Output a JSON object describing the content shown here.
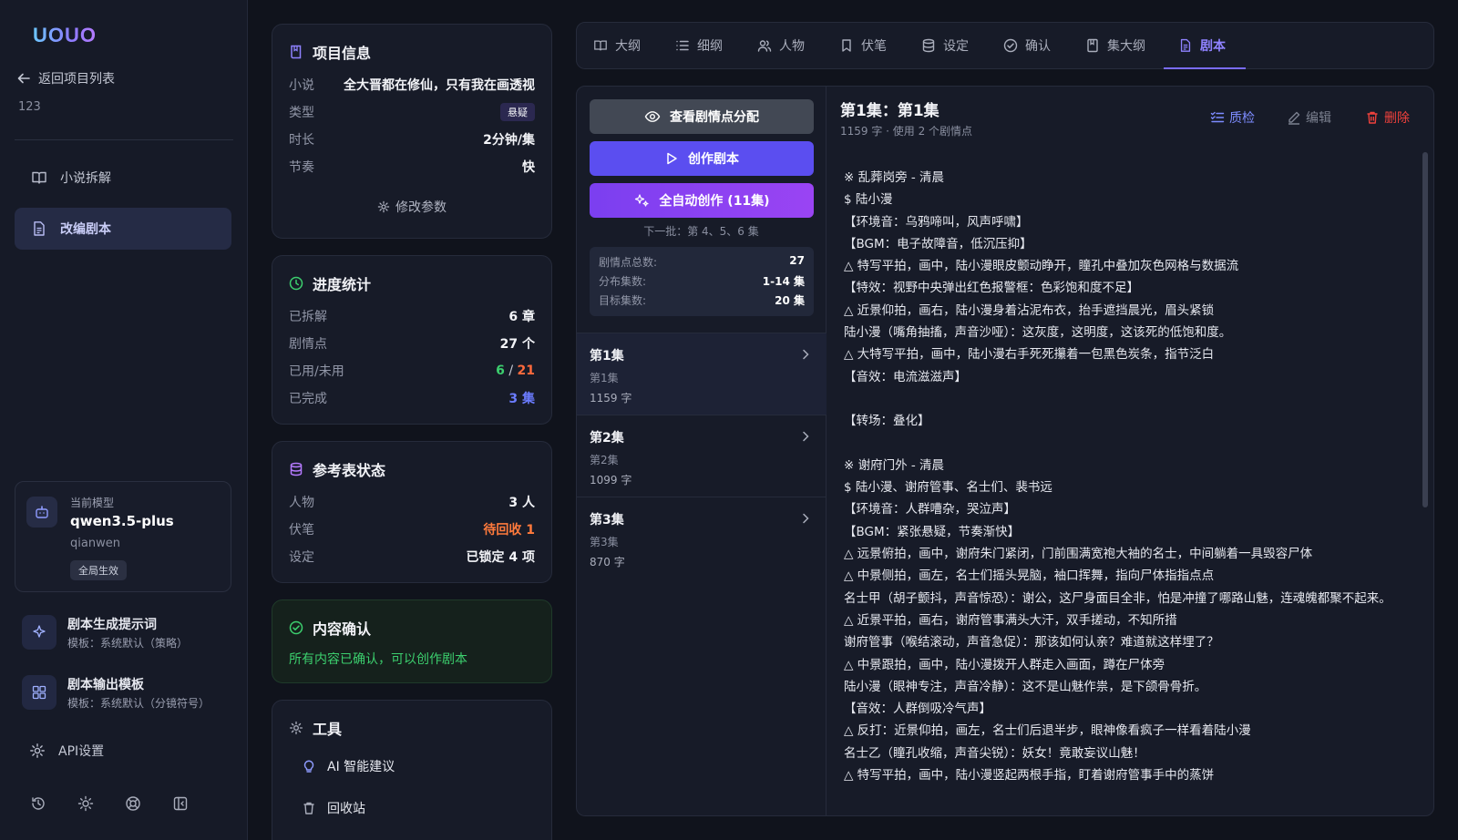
{
  "brand": {
    "logo_text": "UOUO"
  },
  "sidebar": {
    "back_label": "返回项目列表",
    "project_id": "123",
    "items": [
      {
        "label": "小说拆解",
        "icon": "book-icon",
        "active": false
      },
      {
        "label": "改编剧本",
        "icon": "document-icon",
        "active": true
      }
    ],
    "model": {
      "label": "当前模型",
      "name": "qwen3.5-plus",
      "provider": "qianwen",
      "badge": "全局生效"
    },
    "templates": [
      {
        "title": "剧本生成提示词",
        "sub": "模板：系统默认（策略）",
        "icon": "sparkle-icon"
      },
      {
        "title": "剧本输出模板",
        "sub": "模板：系统默认（分镜符号）",
        "icon": "grid-icon"
      }
    ],
    "api_label": "API设置",
    "bottom_icons": [
      "history-icon",
      "sun-icon",
      "support-icon",
      "collapse-sidebar-icon"
    ]
  },
  "project_info": {
    "title": "项目信息",
    "rows": [
      {
        "k": "小说",
        "v": "全大晋都在修仙，只有我在画透视"
      },
      {
        "k": "类型",
        "v": "悬疑"
      },
      {
        "k": "时长",
        "v": "2分钟/集"
      },
      {
        "k": "节奏",
        "v": "快"
      }
    ],
    "modify_label": "修改参数"
  },
  "progress": {
    "title": "进度统计",
    "rows": [
      {
        "k": "已拆解",
        "v": "6 章"
      },
      {
        "k": "剧情点",
        "v": "27 个"
      },
      {
        "k": "已用/未用",
        "used": "6",
        "sep": " / ",
        "unused": "21"
      },
      {
        "k": "已完成",
        "v": "3 集"
      }
    ]
  },
  "reference": {
    "title": "参考表状态",
    "rows": [
      {
        "k": "人物",
        "v": "3 人"
      },
      {
        "k": "伏笔",
        "v": "待回收 1"
      },
      {
        "k": "设定",
        "v": "已锁定 4 项"
      }
    ]
  },
  "confirm": {
    "title": "内容确认",
    "message": "所有内容已确认，可以创作剧本"
  },
  "tools": {
    "title": "工具",
    "items": [
      {
        "label": "AI 智能建议",
        "icon": "lightbulb-icon"
      },
      {
        "label": "回收站",
        "icon": "trash-icon"
      }
    ]
  },
  "tabs": [
    {
      "label": "大纲",
      "icon": "book-open-icon"
    },
    {
      "label": "细纲",
      "icon": "list-icon"
    },
    {
      "label": "人物",
      "icon": "users-icon"
    },
    {
      "label": "伏笔",
      "icon": "bookmark-icon"
    },
    {
      "label": "设定",
      "icon": "database-icon"
    },
    {
      "label": "确认",
      "icon": "check-circle-icon"
    },
    {
      "label": "集大纲",
      "icon": "notebook-icon"
    },
    {
      "label": "剧本",
      "icon": "file-text-icon",
      "active": true
    }
  ],
  "actions": {
    "view_distribution": "查看剧情点分配",
    "create_script": "创作剧本",
    "auto_create": "全自动创作 (11集)",
    "next_batch": "下一批：第 4、5、6 集"
  },
  "plot_stats": [
    {
      "k": "剧情点总数:",
      "v": "27"
    },
    {
      "k": "分布集数:",
      "v": "1-14 集"
    },
    {
      "k": "目标集数:",
      "v": "20 集"
    }
  ],
  "episodes": [
    {
      "title": "第1集",
      "sub": "第1集",
      "count": "1159 字",
      "active": true
    },
    {
      "title": "第2集",
      "sub": "第2集",
      "count": "1099 字",
      "active": false
    },
    {
      "title": "第3集",
      "sub": "第3集",
      "count": "870 字",
      "active": false
    }
  ],
  "episode_detail": {
    "title": "第1集：第1集",
    "meta": "1159 字 · 使用 2 个剧情点",
    "qc_label": "质检",
    "edit_label": "编辑",
    "delete_label": "删除",
    "script": "※ 乱葬岗旁 - 清晨\n$ 陆小漫\n【环境音：乌鸦啼叫，风声呼啸】\n【BGM：电子故障音，低沉压抑】\n△ 特写平拍，画中，陆小漫眼皮颤动睁开，瞳孔中叠加灰色网格与数据流\n【特效：视野中央弹出红色报警框：色彩饱和度不足】\n△ 近景仰拍，画右，陆小漫身着沾泥布衣，抬手遮挡晨光，眉头紧锁\n陆小漫（嘴角抽搐，声音沙哑）：这灰度，这明度，这该死的低饱和度。\n△ 大特写平拍，画中，陆小漫右手死死攥着一包黑色炭条，指节泛白\n【音效：电流滋滋声】\n\n【转场：叠化】\n\n※ 谢府门外 - 清晨\n$ 陆小漫、谢府管事、名士们、裴书远\n【环境音：人群嘈杂，哭泣声】\n【BGM：紧张悬疑，节奏渐快】\n△ 远景俯拍，画中，谢府朱门紧闭，门前围满宽袍大袖的名士，中间躺着一具毁容尸体\n△ 中景侧拍，画左，名士们摇头晃脑，袖口挥舞，指向尸体指指点点\n名士甲（胡子颤抖，声音惊恐）：谢公，这尸身面目全非，怕是冲撞了哪路山魅，连魂魄都聚不起来。\n△ 近景平拍，画右，谢府管事满头大汗，双手搓动，不知所措\n谢府管事（喉结滚动，声音急促）：那该如何认亲？难道就这样埋了？\n△ 中景跟拍，画中，陆小漫拨开人群走入画面，蹲在尸体旁\n陆小漫（眼神专注，声音冷静）：这不是山魅作祟，是下颌骨骨折。\n【音效：人群倒吸冷气声】\n△ 反打：近景仰拍，画左，名士们后退半步，眼神像看疯子一样看着陆小漫\n名士乙（瞳孔收缩，声音尖锐）：妖女！竟敢妄议山魅！\n△ 特写平拍，画中，陆小漫竖起两根手指，盯着谢府管事手中的蒸饼"
  },
  "colors": {
    "accent": "#5b4ef0",
    "purple": "#8f82ff",
    "green": "#3ccf6e",
    "red": "#f0413c",
    "orange": "#ff7a3c",
    "blue": "#6b7cff",
    "bg": "#10131c"
  }
}
